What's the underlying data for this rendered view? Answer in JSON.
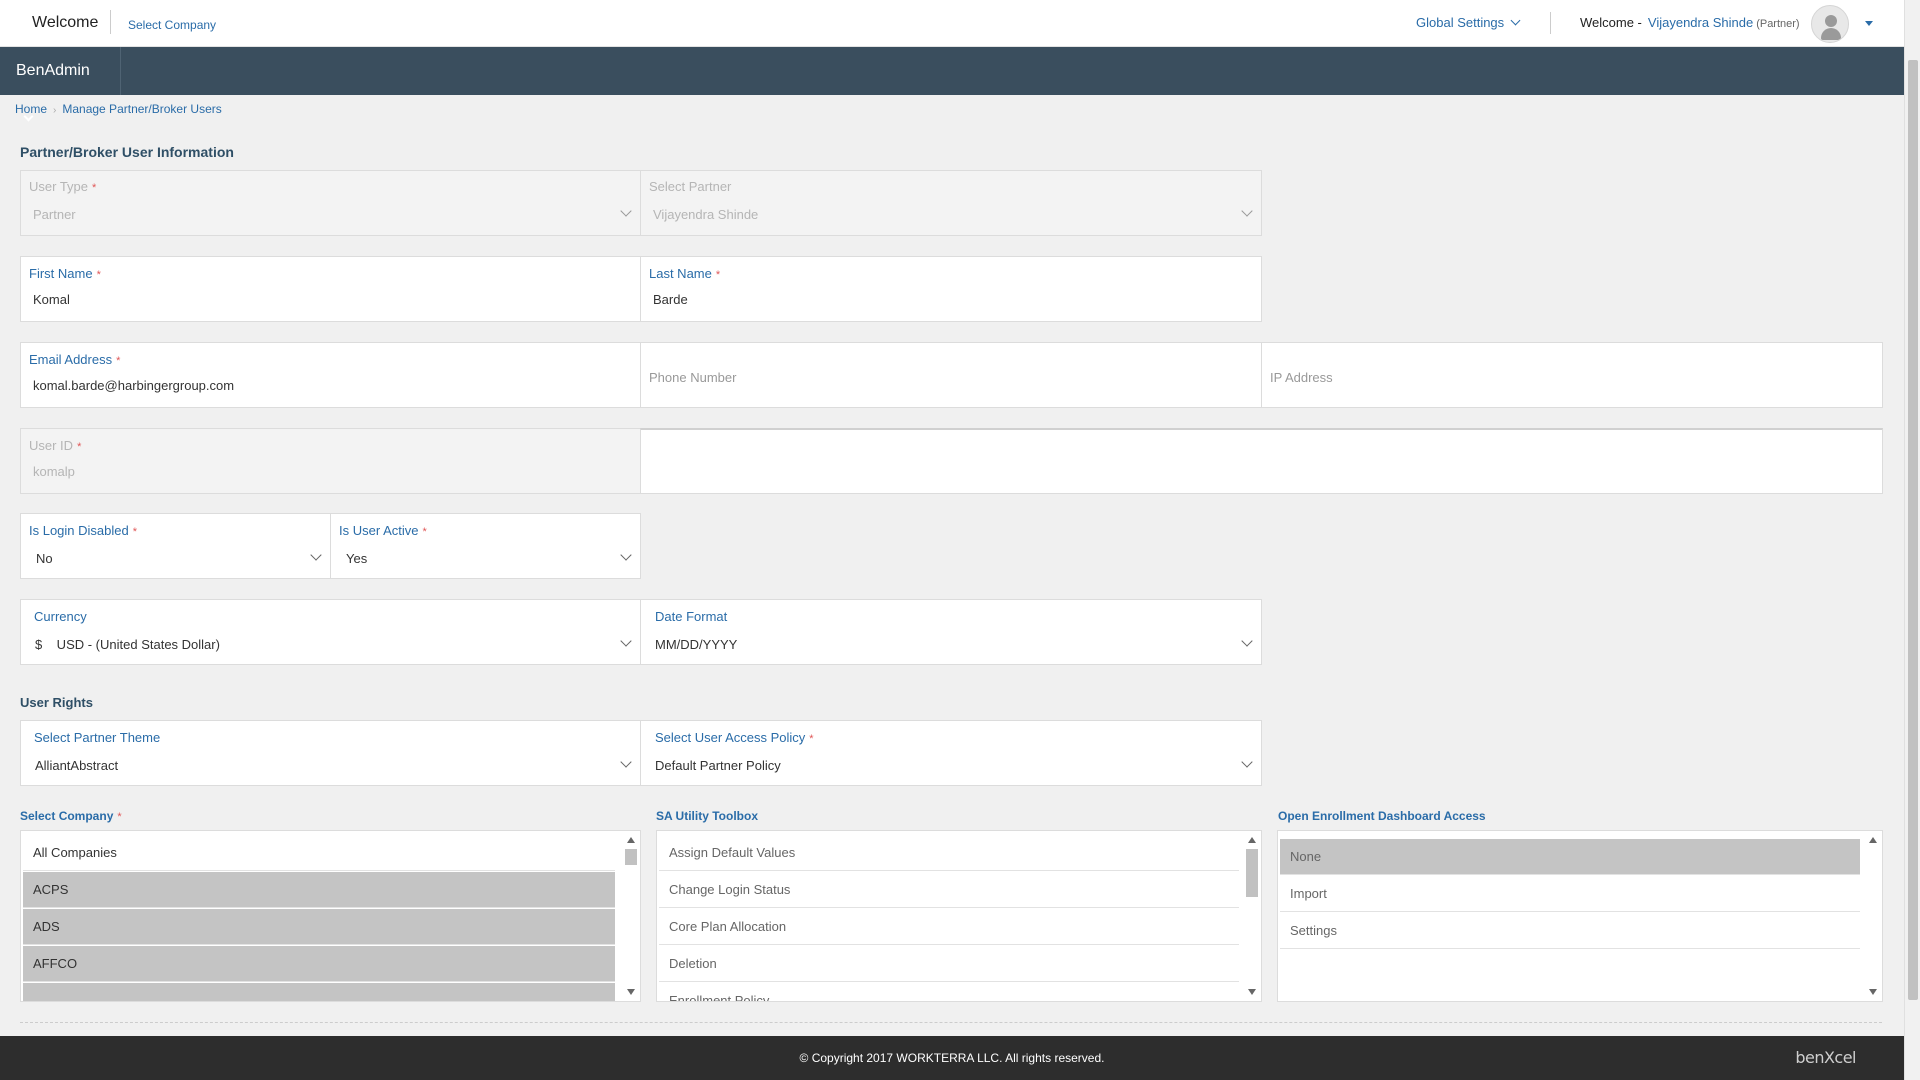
{
  "header": {
    "welcome": "Welcome",
    "select_company": "Select Company",
    "global_settings": "Global Settings",
    "welcome_prefix": "Welcome -",
    "user_name": "Vijayendra Shinde",
    "user_role": "(Partner)"
  },
  "nav": {
    "app_name": "BenAdmin"
  },
  "breadcrumb": {
    "home": "Home",
    "current": "Manage Partner/Broker Users"
  },
  "sections": {
    "user_info": "Partner/Broker User Information",
    "user_rights": "User Rights"
  },
  "form": {
    "user_type": {
      "label": "User Type",
      "value": "Partner"
    },
    "select_partner": {
      "label": "Select Partner",
      "value": "Vijayendra Shinde"
    },
    "first_name": {
      "label": "First Name",
      "value": "Komal"
    },
    "last_name": {
      "label": "Last Name",
      "value": "Barde"
    },
    "email": {
      "label": "Email Address",
      "value": "komal.barde@harbingergroup.com"
    },
    "phone": {
      "placeholder": "Phone Number"
    },
    "ip": {
      "placeholder": "IP Address"
    },
    "user_id": {
      "label": "User ID",
      "value": "komalp"
    },
    "is_login_disabled": {
      "label": "Is Login Disabled",
      "value": "No"
    },
    "is_user_active": {
      "label": "Is User Active",
      "value": "Yes"
    },
    "currency": {
      "label": "Currency",
      "value": "$    USD - (United States Dollar)"
    },
    "date_format": {
      "label": "Date Format",
      "value": "MM/DD/YYYY"
    },
    "partner_theme": {
      "label": "Select Partner Theme",
      "value": "AlliantAbstract"
    },
    "access_policy": {
      "label": "Select User Access Policy",
      "value": "Default Partner Policy"
    },
    "required_mark": "*"
  },
  "lists": {
    "select_company": {
      "label": "Select Company",
      "items": [
        "All Companies",
        "ACPS",
        "ADS",
        "AFFCO"
      ]
    },
    "sa_utility": {
      "label": "SA Utility Toolbox",
      "items": [
        "Assign Default Values",
        "Change Login Status",
        "Core Plan Allocation",
        "Deletion",
        "Enrollment Policy"
      ]
    },
    "oe_dashboard": {
      "label": "Open Enrollment Dashboard Access",
      "items": [
        "None",
        "Import",
        "Settings"
      ]
    }
  },
  "footer": {
    "copyright": "© Copyright 2017 WORKTERRA LLC. All rights reserved.",
    "logo": "benXcel"
  }
}
